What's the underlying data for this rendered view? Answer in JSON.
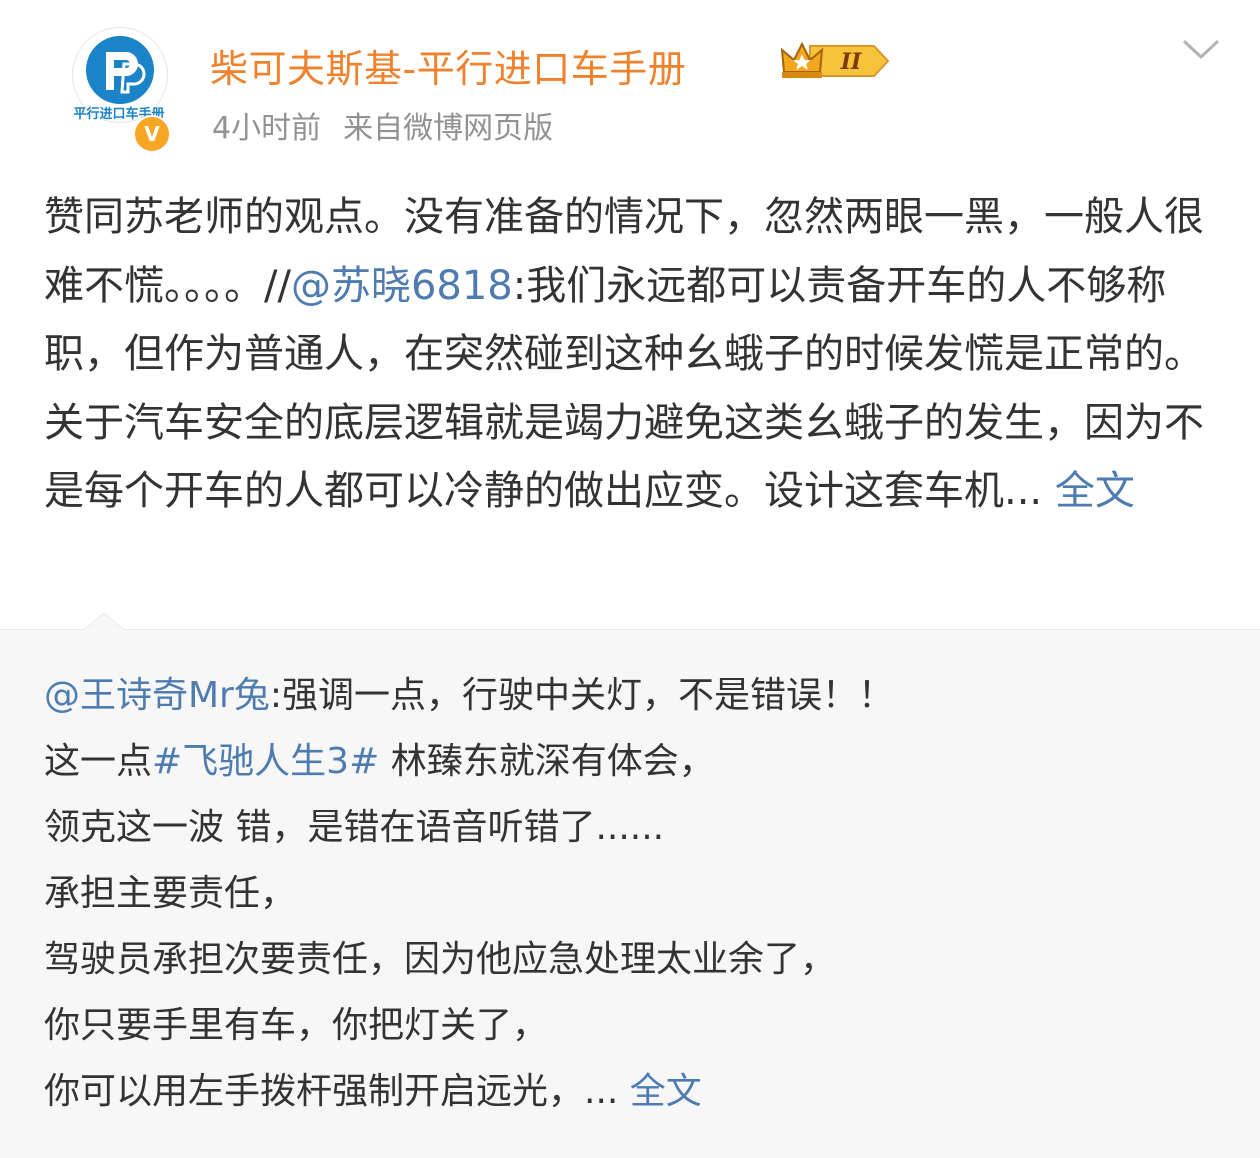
{
  "author": {
    "name": "柴可夫斯基-平行进口车手册",
    "avatar_label": "平行进口车手册",
    "verified_mark": "V",
    "level_badge": "II",
    "time": "4小时前",
    "source": "来自微博网页版"
  },
  "post": {
    "text_part1": "赞同苏老师的观点。没有准备的情况下，忽然两眼一黑，一般人很难不慌。。。。//",
    "mention": "@苏晓6818",
    "text_part2": ":我们永远都可以责备开车的人不够称职，但作为普通人，在突然碰到这种幺蛾子的时候发慌是正常的。关于汽车安全的底层逻辑就是竭力避免这类幺蛾子的发生，因为不是每个开车的人都可以冷静的做出应变。设计这套车机... ",
    "more_label": "全文"
  },
  "repost": {
    "mention": "@王诗奇Mr兔",
    "line1": ":强调一点，行驶中关灯，不是错误！！",
    "line2_a": "这一点",
    "hashtag": "#飞驰人生3#",
    "line2_b": " 林臻东就深有体会，",
    "line3": "领克这一波 错，是错在语音听错了......",
    "line4": "承担主要责任，",
    "line5": "驾驶员承担次要责任，因为他应急处理太业余了，",
    "line6": "你只要手里有车，你把灯关了，",
    "line7": "你可以用左手拨杆强制开启远光，... ",
    "more_label": "全文"
  },
  "colors": {
    "username": "#f0812d",
    "link": "#4f7cb0",
    "meta": "#929292",
    "repost_bg": "#f7f7f7",
    "verified": "#f6a623"
  },
  "icons": {
    "menu": "chevron-down-icon",
    "badge": "crown-icon",
    "verified": "verified-icon"
  }
}
